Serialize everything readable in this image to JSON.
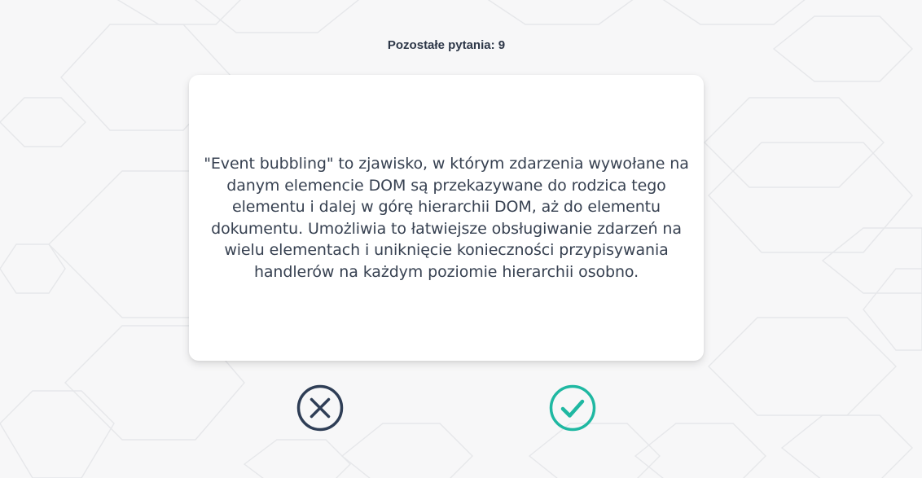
{
  "counter": {
    "label": "Pozostałe pytania: 9"
  },
  "card": {
    "text": "\"Event bubbling\" to zjawisko, w którym zdarzenia wywołane na danym elemencie DOM są przekazywane do rodzica tego elementu i dalej w górę hierarchii DOM, aż do elementu dokumentu. Umożliwia to łatwiejsze obsługiwanie zdarzeń na wielu elementach i uniknięcie konieczności przypisywania handlerów na każdym poziomie hierarchii osobno."
  },
  "actions": {
    "reject": {
      "icon": "x-circle-icon",
      "color": "#2f3e56"
    },
    "accept": {
      "icon": "check-circle-icon",
      "color": "#1fb8a2"
    }
  },
  "theme": {
    "background": "#f7f7f8",
    "card": "#ffffff",
    "text": "#374151"
  }
}
